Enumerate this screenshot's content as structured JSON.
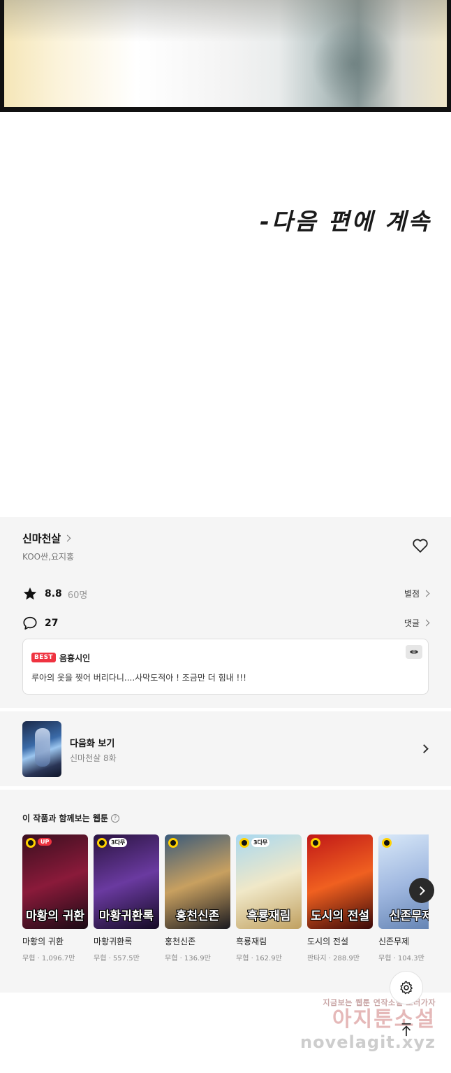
{
  "comic": {
    "continue_text": "-다음 편에 계속"
  },
  "info": {
    "title": "신마천살",
    "authors": "KOO싼,요지홍",
    "rating_score": "8.8",
    "rating_count": "60명",
    "rating_link": "별점",
    "comment_count": "27",
    "comment_link": "댓글",
    "best_comment": {
      "badge": "BEST",
      "user": "음흉시인",
      "text": "루아의 옷을 찢어 버리다니....사막도적아 ! 조금만 더 힘내 !!!"
    }
  },
  "next_episode": {
    "title": "다음화 보기",
    "subtitle": "신마천살 8화"
  },
  "recommend": {
    "header": "이 작품과 함께보는 웹툰",
    "items": [
      {
        "name": "마황의 귀환",
        "meta": "무협 · 1,096.7만",
        "cover_text": "마황의 귀환",
        "tag": "UP",
        "colors": [
          "#3a0f1f",
          "#8a1a3a",
          "#1a0a14"
        ]
      },
      {
        "name": "마황귀환록",
        "meta": "무협 · 557.5만",
        "cover_text": "마황귀환록",
        "tag": "3다무",
        "colors": [
          "#2a1440",
          "#6a3aa0",
          "#140a24"
        ]
      },
      {
        "name": "홍천신존",
        "meta": "무협 · 136.9만",
        "cover_text": "홍천신존",
        "tag": "",
        "colors": [
          "#3a5a7a",
          "#c8a060",
          "#1a1a20"
        ]
      },
      {
        "name": "흑룡재림",
        "meta": "무협 · 162.9만",
        "cover_text": "흑룡재림",
        "tag": "3다무",
        "colors": [
          "#a8d8f0",
          "#f0e8c8",
          "#c0a060"
        ]
      },
      {
        "name": "도시의 전설",
        "meta": "판타지 · 288.9만",
        "cover_text": "도시의 전설",
        "tag": "",
        "colors": [
          "#c01818",
          "#f06020",
          "#3a0808"
        ]
      },
      {
        "name": "신존무제",
        "meta": "무협 · 104.3만",
        "cover_text": "신존무제",
        "tag": "",
        "colors": [
          "#d8e8f8",
          "#a0b8e0",
          "#6080b0"
        ]
      }
    ]
  },
  "watermark": {
    "line1": "지금보는 웹툰 연작소설 보러가자",
    "line2": "아지툰소설",
    "line3": "novelagit.xyz"
  }
}
